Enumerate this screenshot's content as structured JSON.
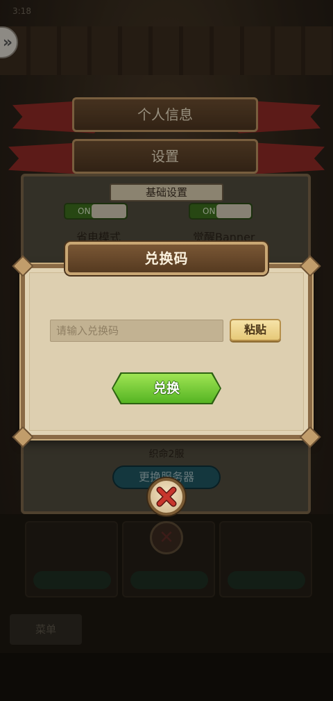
{
  "status_bar": {
    "left": "3:18"
  },
  "background": {
    "header_profile": "个人信息",
    "header_settings": "设置",
    "section_basic": "基础设置",
    "toggle_on_label": "ON",
    "power_saving": "省电模式",
    "wake_banner": "觉醒Banner",
    "server_name": "织命2服",
    "change_server": "更换服务器",
    "bottom_tab": "菜单"
  },
  "dialog": {
    "title": "兑换码",
    "input_placeholder": "请输入兑换码",
    "input_value": "",
    "paste_label": "粘贴",
    "redeem_label": "兑换"
  },
  "colors": {
    "redeem_green": "#6cc52f",
    "paste_gold": "#eed18c",
    "close_red": "#b7322b",
    "panel_beige": "#ddcfb0"
  },
  "icons": {
    "back": "double-chevron-left-icon",
    "close": "close-x-icon"
  }
}
